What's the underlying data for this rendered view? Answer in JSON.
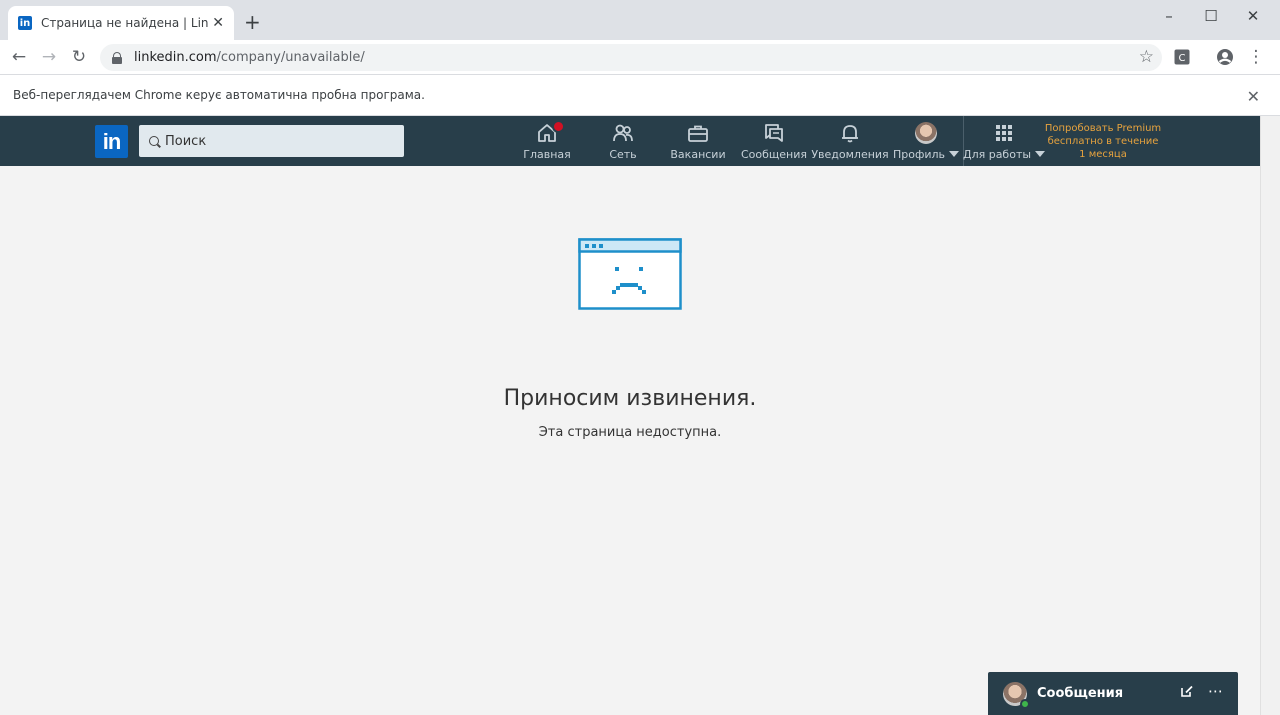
{
  "browser": {
    "tab_title": "Страница не найдена | LinkedIn",
    "tab_favicon": "in",
    "url_host": "linkedin.com",
    "url_path": "/company/unavailable/",
    "infobar_text": "Веб-переглядачем Chrome керує автоматична пробна програма."
  },
  "nav": {
    "logo_text": "in",
    "search_placeholder": "Поиск",
    "items": [
      {
        "label": "Главная",
        "icon": "home-icon"
      },
      {
        "label": "Сеть",
        "icon": "network-icon"
      },
      {
        "label": "Вакансии",
        "icon": "briefcase-icon"
      },
      {
        "label": "Сообщения",
        "icon": "messages-icon"
      },
      {
        "label": "Уведомления",
        "icon": "bell-icon"
      },
      {
        "label": "Профиль",
        "icon": "avatar"
      },
      {
        "label": "Для работы",
        "icon": "grid-icon"
      }
    ],
    "premium_lines": [
      "Попробовать Premium",
      "бесплатно в течение",
      "1 месяца"
    ]
  },
  "main": {
    "title": "Приносим извинения.",
    "subtitle": "Эта страница недоступна."
  },
  "messaging": {
    "label": "Сообщения"
  },
  "colors": {
    "nav_bg": "#283e4a",
    "brand_blue": "#0a66c2",
    "premium_gold": "#e7a33e",
    "illustration_blue": "#1e8fca",
    "badge_red": "#d11124"
  }
}
